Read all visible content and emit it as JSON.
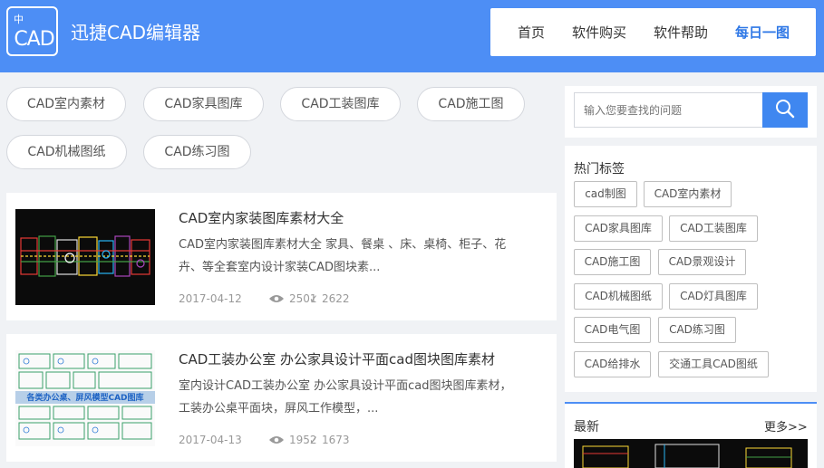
{
  "header": {
    "logo_text": "CAD",
    "logo_mini": "中",
    "site_title": "迅捷CAD编辑器",
    "nav": [
      {
        "label": "首页"
      },
      {
        "label": "软件购买"
      },
      {
        "label": "软件帮助"
      },
      {
        "label": "每日一图",
        "active": true
      }
    ]
  },
  "categories": [
    "CAD室内素材",
    "CAD家具图库",
    "CAD工装图库",
    "CAD施工图",
    "CAD机械图纸",
    "CAD练习图"
  ],
  "articles": [
    {
      "title": "CAD室内家装图库素材大全",
      "description_line1": "CAD室内家装图库素材大全 家具、餐桌 、床、桌椅、柜子、花",
      "description_line2": "卉、等全套室内设计家装CAD图块素...",
      "date": "2017-04-12",
      "views": "2501",
      "likes": "2622"
    },
    {
      "title": "CAD工装办公室 办公家具设计平面cad图块图库素材",
      "description_line1": "室内设计CAD工装办公室 办公家具设计平面cad图块图库素材，",
      "description_line2": "工装办公桌平面块，屏风工作模型，...",
      "date": "2017-04-13",
      "views": "1952",
      "likes": "1673",
      "thumb_caption": "各类办公桌、屏风模型CAD图库"
    }
  ],
  "sidebar": {
    "search_placeholder": "输入您要查找的问题",
    "tags_title": "热门标签",
    "tags": [
      "cad制图",
      "CAD室内素材",
      "CAD家具图库",
      "CAD工装图库",
      "CAD施工图",
      "CAD景观设计",
      "CAD机械图纸",
      "CAD灯具图库",
      "CAD电气图",
      "CAD练习图",
      "CAD给排水",
      "交通工具CAD图纸"
    ],
    "latest_title": "最新",
    "more_label": "更多>>"
  },
  "colors": {
    "header_bg": "#4d8ef5",
    "accent": "#2f78e6",
    "search_button": "#3f87f0"
  },
  "icons": {
    "search": "search-icon",
    "views": "eye-icon",
    "likes": "like-icon"
  }
}
